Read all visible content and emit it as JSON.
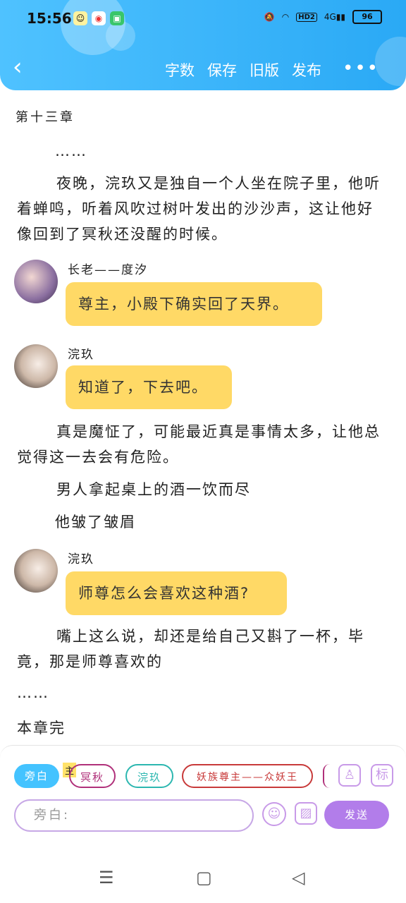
{
  "status": {
    "time": "15:56",
    "network": "4G",
    "battery": "96",
    "hd": "HD2"
  },
  "nav": {
    "back_icon": "chevron-left-icon",
    "actions": [
      "字数",
      "保存",
      "旧版",
      "发布"
    ],
    "more": "•••"
  },
  "content": {
    "chapter_title": "第十三章",
    "ellipsis_top": "……",
    "paragraph1": "夜晚，浣玖又是独自一个人坐在院子里，他听着蝉鸣，听着风吹过树叶发出的沙沙声，这让他好像回到了冥秋还没醒的时候。",
    "dialogue": [
      {
        "speaker": "长老——度汐",
        "text": "尊主，小殿下确实回了天界。"
      },
      {
        "speaker": "浣玖",
        "text": "知道了，下去吧。"
      }
    ],
    "paragraph2": "真是魔怔了，可能最近真是事情太多，让他总觉得这一去会有危险。",
    "paragraph3": "男人拿起桌上的酒一饮而尽",
    "paragraph4": "他皱了皱眉",
    "dialogue2": {
      "speaker": "浣玖",
      "text": "师尊怎么会喜欢这种酒?"
    },
    "paragraph5": "嘴上这么说，却还是给自己又斟了一杯，毕竟，那是师尊喜欢的",
    "ellipsis_bottom": "……",
    "end_text": "本章完"
  },
  "editor": {
    "chips": [
      "旁白",
      "冥秋",
      "浣玖",
      "妖族尊主——众妖王"
    ],
    "chip_tag": "主",
    "input_placeholder": "旁白:",
    "send_label": "发送",
    "right_icon_label": "标"
  },
  "colors": {
    "header": "#2aa9f5",
    "bubble": "#ffd966",
    "send": "#b27dea",
    "chip_active": "#44c3ff"
  }
}
